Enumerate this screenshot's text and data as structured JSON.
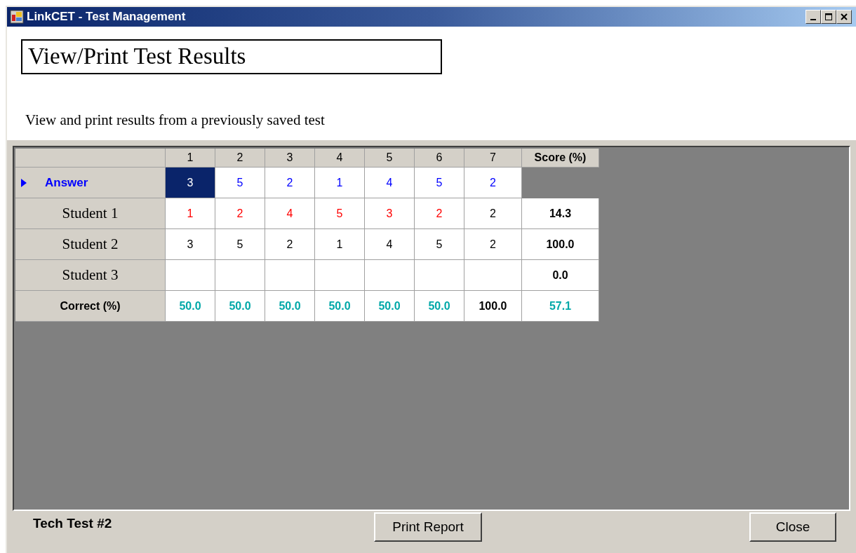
{
  "window": {
    "title": "LinkCET - Test Management"
  },
  "heading": "View/Print Test Results",
  "description": "View and print results from a previously saved test",
  "grid": {
    "columns": [
      "1",
      "2",
      "3",
      "4",
      "5",
      "6",
      "7",
      "Score (%)"
    ],
    "rows": [
      {
        "label": "Answer",
        "kind": "answer",
        "current": true,
        "cells": [
          {
            "text": "3",
            "selected": true
          },
          {
            "text": "5",
            "color": "#0000ff",
            "selected": false
          },
          {
            "text": "2",
            "color": "#0000ff",
            "selected": false
          },
          {
            "text": "1",
            "color": "#0000ff",
            "selected": false
          },
          {
            "text": "4",
            "color": "#0000ff",
            "selected": false
          },
          {
            "text": "5",
            "color": "#0000ff",
            "selected": false
          },
          {
            "text": "2",
            "color": "#0000ff",
            "selected": false
          }
        ]
      },
      {
        "label": "Student 1",
        "kind": "student",
        "current": false,
        "cells": [
          {
            "text": "1",
            "color": "#ff0000",
            "selected": false
          },
          {
            "text": "2",
            "color": "#ff0000",
            "selected": false
          },
          {
            "text": "4",
            "color": "#ff0000",
            "selected": false
          },
          {
            "text": "5",
            "color": "#ff0000",
            "selected": false
          },
          {
            "text": "3",
            "color": "#ff0000",
            "selected": false
          },
          {
            "text": "2",
            "color": "#ff0000",
            "selected": false
          },
          {
            "text": "2",
            "color": "#000000",
            "selected": false
          }
        ],
        "score": {
          "text": "14.3",
          "color": "#000000"
        }
      },
      {
        "label": "Student 2",
        "kind": "student",
        "current": false,
        "cells": [
          {
            "text": "3",
            "color": "#000000",
            "selected": false
          },
          {
            "text": "5",
            "color": "#000000",
            "selected": false
          },
          {
            "text": "2",
            "color": "#000000",
            "selected": false
          },
          {
            "text": "1",
            "color": "#000000",
            "selected": false
          },
          {
            "text": "4",
            "color": "#000000",
            "selected": false
          },
          {
            "text": "5",
            "color": "#000000",
            "selected": false
          },
          {
            "text": "2",
            "color": "#000000",
            "selected": false
          }
        ],
        "score": {
          "text": "100.0",
          "color": "#000000"
        }
      },
      {
        "label": "Student 3",
        "kind": "student",
        "current": false,
        "cells": [
          {
            "selected": false
          },
          {
            "selected": false
          },
          {
            "selected": false
          },
          {
            "selected": false
          },
          {
            "selected": false
          },
          {
            "selected": false
          },
          {
            "selected": false
          }
        ],
        "score": {
          "text": "0.0",
          "color": "#000000"
        }
      },
      {
        "label": "Correct (%)",
        "kind": "summary",
        "current": false,
        "cells": [
          {
            "text": "50.0",
            "color": "#00a8a8",
            "selected": false
          },
          {
            "text": "50.0",
            "color": "#00a8a8",
            "selected": false
          },
          {
            "text": "50.0",
            "color": "#00a8a8",
            "selected": false
          },
          {
            "text": "50.0",
            "color": "#00a8a8",
            "selected": false
          },
          {
            "text": "50.0",
            "color": "#00a8a8",
            "selected": false
          },
          {
            "text": "50.0",
            "color": "#00a8a8",
            "selected": false
          },
          {
            "text": "100.0",
            "color": "#000000",
            "selected": false
          }
        ],
        "score": {
          "text": "57.1",
          "color": "#00a8a8"
        }
      }
    ]
  },
  "test_name": "Tech Test #2",
  "buttons": [
    "Print Report",
    "Close"
  ]
}
